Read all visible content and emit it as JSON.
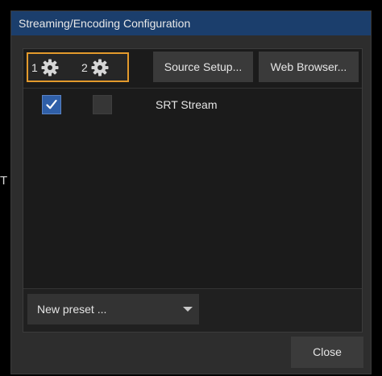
{
  "edge_glyph": "T",
  "window": {
    "title": "Streaming/Encoding Configuration"
  },
  "toolbar": {
    "outputs": [
      {
        "number": "1",
        "icon": "gear-icon"
      },
      {
        "number": "2",
        "icon": "gear-icon"
      }
    ],
    "highlight_color": "#e39a2c",
    "source_setup_label": "Source Setup...",
    "web_browser_label": "Web Browser..."
  },
  "streams": [
    {
      "name": "SRT Stream",
      "output1_checked": true,
      "output2_checked": false
    }
  ],
  "preset": {
    "selected": "New preset ..."
  },
  "footer": {
    "close_label": "Close"
  },
  "colors": {
    "titlebar": "#1b3e6c",
    "checkbox_checked": "#2f5fa8"
  }
}
